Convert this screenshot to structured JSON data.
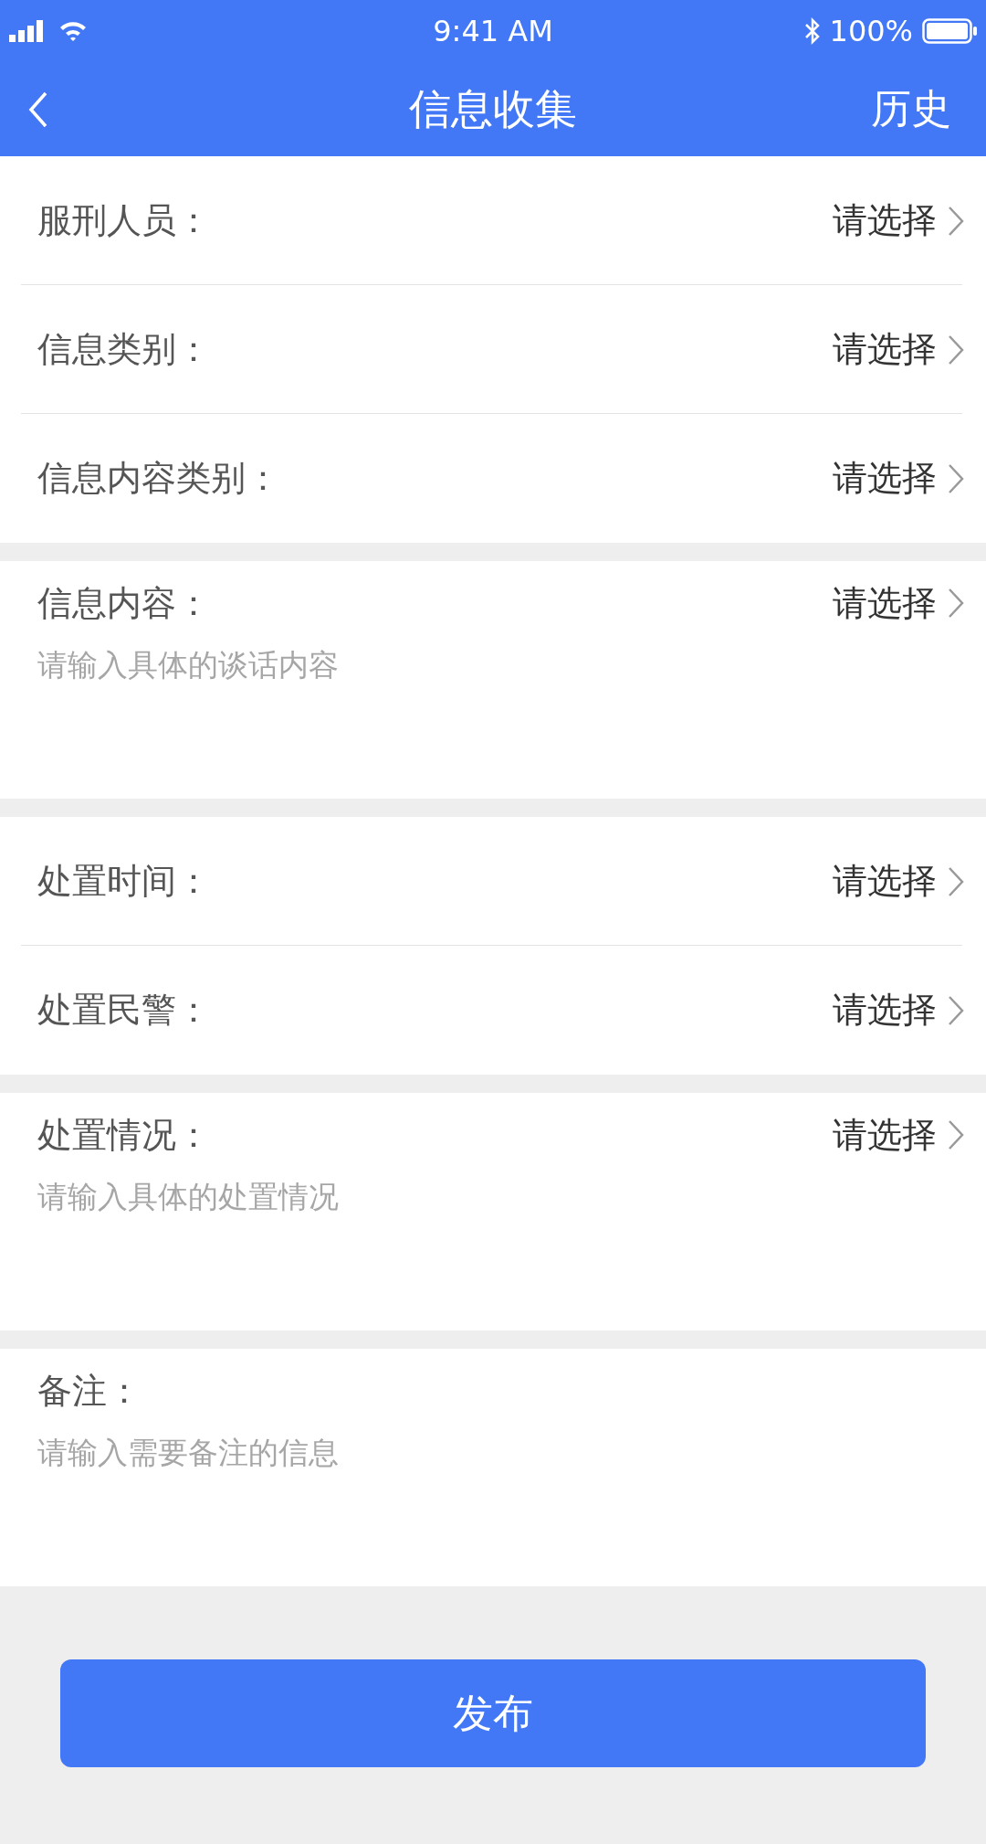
{
  "status_bar": {
    "time": "9:41 AM",
    "battery_text": "100%"
  },
  "nav": {
    "title": "信息收集",
    "action": "历史"
  },
  "sections": [
    {
      "items": [
        {
          "kind": "select",
          "label": "服刑人员：",
          "value": "请选择"
        },
        {
          "kind": "select",
          "label": "信息类别：",
          "value": "请选择"
        },
        {
          "kind": "select",
          "label": "信息内容类别：",
          "value": "请选择"
        }
      ]
    },
    {
      "items": [
        {
          "kind": "note",
          "label": "信息内容：",
          "value": "请选择",
          "placeholder": "请输入具体的谈话内容"
        }
      ]
    },
    {
      "items": [
        {
          "kind": "select",
          "label": "处置时间：",
          "value": "请选择"
        },
        {
          "kind": "select",
          "label": "处置民警：",
          "value": "请选择"
        }
      ]
    },
    {
      "items": [
        {
          "kind": "note",
          "label": "处置情况：",
          "value": "请选择",
          "placeholder": "请输入具体的处置情况"
        }
      ]
    },
    {
      "items": [
        {
          "kind": "note",
          "label": "备注：",
          "placeholder": "请输入需要备注的信息"
        }
      ]
    }
  ],
  "submit": "发布"
}
